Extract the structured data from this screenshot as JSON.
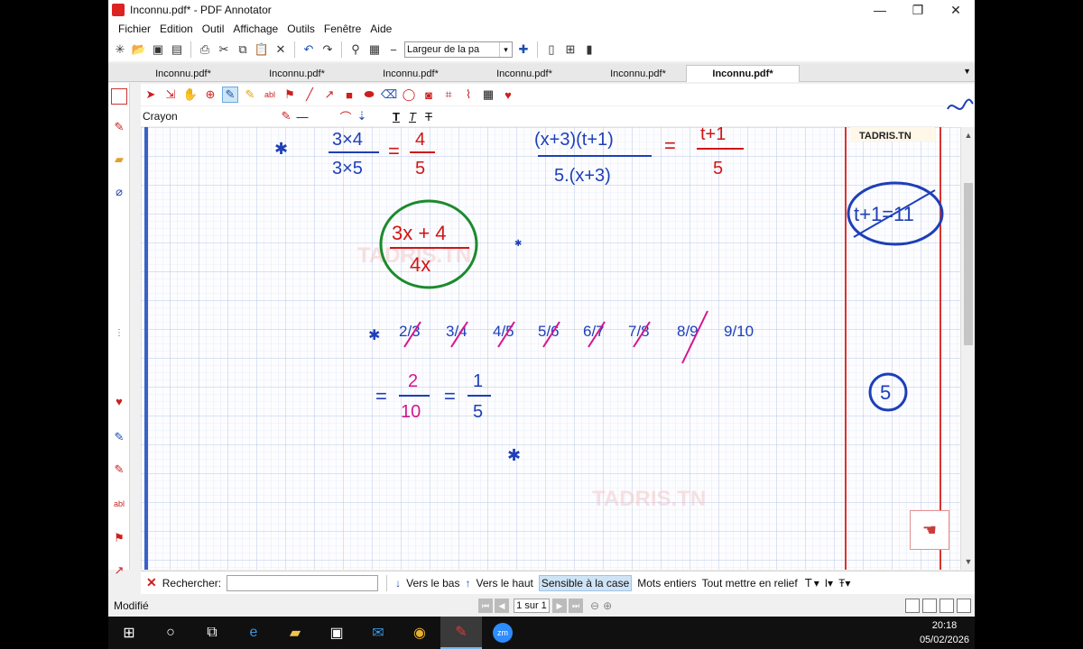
{
  "window": {
    "title": "Inconnu.pdf* - PDF Annotator"
  },
  "menu": [
    "Fichier",
    "Edition",
    "Outil",
    "Affichage",
    "Outils",
    "Fenêtre",
    "Aide"
  ],
  "toolbar": {
    "zoom_value": "Largeur de la pa"
  },
  "tabs": [
    "Inconnu.pdf*",
    "Inconnu.pdf*",
    "Inconnu.pdf*",
    "Inconnu.pdf*",
    "Inconnu.pdf*",
    "Inconnu.pdf*"
  ],
  "active_tab": 5,
  "annotation": {
    "tool_name": "Crayon",
    "text_tools": [
      "T",
      "T",
      "T"
    ]
  },
  "document": {
    "watermark": "TADRIS.TN",
    "handwriting": {
      "eq1_num": "3×4",
      "eq1_den": "3×5",
      "eq1_res_num": "4",
      "eq1_res_den": "5",
      "eq2_num": "(x+3)(t+1)",
      "eq2_den": "5.(x+3)",
      "eq2_res_num": "t+1",
      "eq2_res_den": "5",
      "circle_num": "3x + 4",
      "circle_den": "4x",
      "boxed": "t+1=11",
      "product": [
        "2/3",
        "3/4",
        "4/5",
        "5/6",
        "6/7",
        "7/8",
        "8/9",
        "9/10"
      ],
      "result_num": "2",
      "result_den": "10",
      "final_num": "1",
      "final_den": "5",
      "margin_answer": "5"
    }
  },
  "search": {
    "label": "Rechercher:",
    "value": "",
    "down": "Vers le bas",
    "up": "Vers le haut",
    "case": "Sensible à la case",
    "whole": "Mots entiers",
    "highlight": "Tout mettre en relief"
  },
  "status": {
    "text": "Modifié",
    "page": "1 sur 1"
  },
  "taskbar": {
    "time": "20:18",
    "date": "05/02/2026",
    "zoom_label": "zm"
  },
  "colors": {
    "ink_red": "#d01515",
    "ink_blue": "#1d3fb8",
    "ink_magenta": "#d6168f",
    "ink_green": "#1c8a2c",
    "margin_line": "#d9332f",
    "grid": "#b7c7e6"
  }
}
